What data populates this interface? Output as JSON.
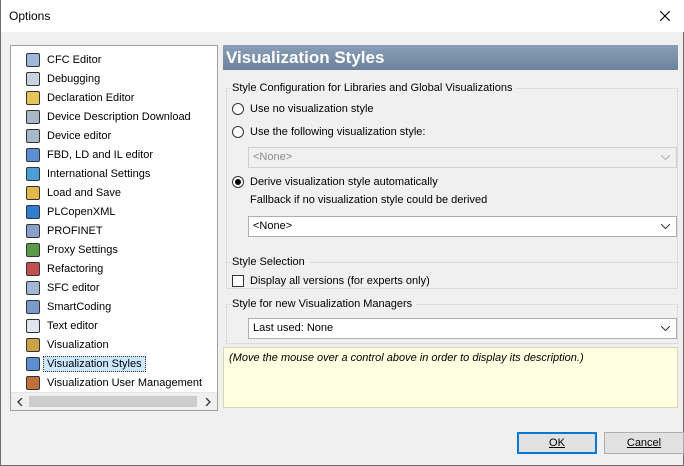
{
  "window": {
    "title": "Options"
  },
  "sidebar": {
    "items": [
      {
        "label": "CFC Editor",
        "icon": "cfc-editor-icon"
      },
      {
        "label": "Debugging",
        "icon": "debugging-icon"
      },
      {
        "label": "Declaration Editor",
        "icon": "declaration-editor-icon"
      },
      {
        "label": "Device Description Download",
        "icon": "device-description-icon"
      },
      {
        "label": "Device editor",
        "icon": "device-editor-icon"
      },
      {
        "label": "FBD, LD and IL editor",
        "icon": "fbd-editor-icon"
      },
      {
        "label": "International Settings",
        "icon": "globe-icon"
      },
      {
        "label": "Load and Save",
        "icon": "folder-icon"
      },
      {
        "label": "PLCopenXML",
        "icon": "plcopenxml-icon"
      },
      {
        "label": "PROFINET",
        "icon": "profinet-icon"
      },
      {
        "label": "Proxy Settings",
        "icon": "proxy-icon"
      },
      {
        "label": "Refactoring",
        "icon": "refactoring-icon"
      },
      {
        "label": "SFC editor",
        "icon": "sfc-editor-icon"
      },
      {
        "label": "SmartCoding",
        "icon": "smartcoding-icon"
      },
      {
        "label": "Text editor",
        "icon": "text-editor-icon"
      },
      {
        "label": "Visualization",
        "icon": "visualization-icon"
      },
      {
        "label": "Visualization Styles",
        "icon": "visualization-styles-icon",
        "selected": true
      },
      {
        "label": "Visualization User Management",
        "icon": "user-management-icon"
      }
    ]
  },
  "panel": {
    "title": "Visualization Styles",
    "group1": {
      "label": "Style Configuration for Libraries and Global Visualizations",
      "radio_none": "Use no visualization style",
      "radio_following": "Use the following visualization style:",
      "combo_following": "<None>",
      "radio_derive": "Derive visualization style automatically",
      "fallback_label": "Fallback if no visualization style could be derived",
      "combo_fallback": "<None>"
    },
    "group2": {
      "label": "Style Selection",
      "check_all_versions": "Display all versions (for experts only)"
    },
    "group3": {
      "label": "Style for new Visualization Managers",
      "combo_last_used": "Last used: None"
    },
    "description": "(Move the mouse over a control above in order to display its description.)"
  },
  "buttons": {
    "ok": "OK",
    "cancel": "Cancel"
  }
}
